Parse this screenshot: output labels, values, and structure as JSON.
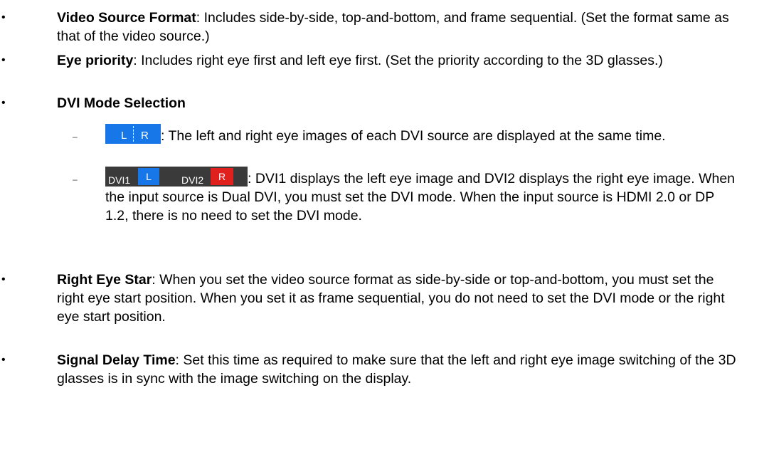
{
  "items": [
    {
      "term": "Video Source Format",
      "desc": ": Includes side-by-side, top-and-bottom, and frame sequential. (Set the format same as that of the video source.)"
    },
    {
      "term": "Eye priority",
      "desc": ": Includes right eye first and left eye first. (Set the priority according to the 3D glasses.)"
    },
    {
      "term": "DVI Mode Selection",
      "desc": ""
    },
    {
      "term": "Right Eye Star",
      "desc": ": When you set the video source format as side-by-side or top-and-bottom, you must set the right eye start position. When you set it as frame sequential, you do not need to set the DVI mode or the right eye start position."
    },
    {
      "term": "Signal Delay Time",
      "desc": ": Set this time as required to make sure that the left and right eye image switching of the 3D glasses is in sync with the image switching on the display."
    }
  ],
  "bullet_char": "•",
  "dash_char": "–",
  "sub_items": [
    {
      "desc": ": The left and right eye images of each DVI source are displayed at the same time.",
      "swatch": {
        "left": "L",
        "right": "R"
      }
    },
    {
      "desc": ": DVI1 displays the left eye image and DVI2 displays the right eye image. When the input source is Dual DVI, you must set the DVI mode. When the input source is HDMI 2.0 or DP 1.2, there is no need to set the DVI mode.",
      "swatch": {
        "dvi1": "DVI1",
        "left": "L",
        "dvi2": "DVI2",
        "right": "R"
      }
    }
  ],
  "colors": {
    "blue": "#1877e8",
    "red": "#e0201c",
    "dark": "#3a3a3a"
  }
}
